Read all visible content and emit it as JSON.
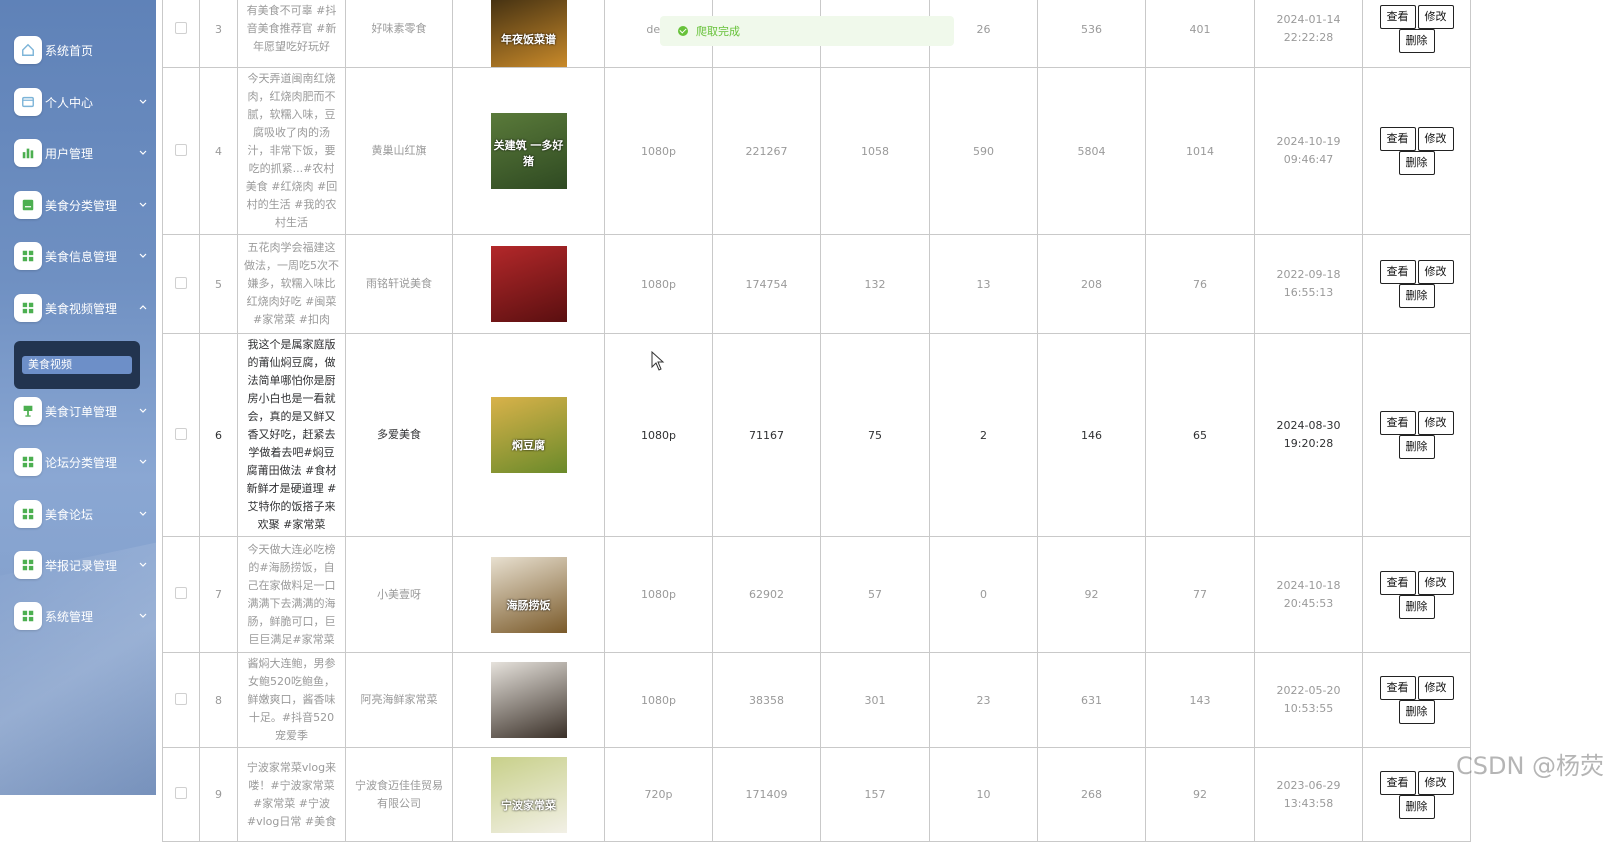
{
  "sidebar": {
    "items": [
      {
        "label": "系统首页",
        "icon": "home-icon",
        "has_chevron": false
      },
      {
        "label": "个人中心",
        "icon": "card-icon",
        "has_chevron": true
      },
      {
        "label": "用户管理",
        "icon": "bar-chart-icon",
        "has_chevron": true
      },
      {
        "label": "美食分类管理",
        "icon": "list-icon",
        "has_chevron": true
      },
      {
        "label": "美食信息管理",
        "icon": "grid-icon",
        "has_chevron": true
      },
      {
        "label": "美食视频管理",
        "icon": "grid-icon",
        "has_chevron": true,
        "expanded": true
      },
      {
        "label": "美食订单管理",
        "icon": "cup-icon",
        "has_chevron": true
      },
      {
        "label": "论坛分类管理",
        "icon": "grid-icon",
        "has_chevron": true
      },
      {
        "label": "美食论坛",
        "icon": "grid-icon",
        "has_chevron": true
      },
      {
        "label": "举报记录管理",
        "icon": "grid-icon",
        "has_chevron": true
      },
      {
        "label": "系统管理",
        "icon": "grid-icon",
        "has_chevron": true
      }
    ],
    "submenu": {
      "active_item": "美食视频"
    }
  },
  "toast": {
    "message": "爬取完成",
    "icon": "check-circle-icon"
  },
  "table": {
    "action_labels": {
      "view": "查看",
      "edit": "修改",
      "delete": "删除"
    },
    "rows": [
      {
        "index": "3",
        "desc": "有美食不可辜 #抖音美食推荐官 #新年愿望吃好玩好",
        "author": "好味素零食",
        "resolution": "de...",
        "c1": "",
        "c2": "",
        "c3": "26",
        "c4": "536",
        "c5": "401",
        "date": "2024-01-14 22:22:28",
        "thumb_text": "年夜饭菜谱",
        "thumb_colors": [
          "#3a2a10",
          "#c98a2a"
        ]
      },
      {
        "index": "4",
        "desc": "今天弄道闽南红烧肉，红烧肉肥而不腻，软糯入味，豆腐吸收了肉的汤汁，非常下饭，要吃的抓紧...#农村美食 #红烧肉 #回村的生活 #我的农村生活",
        "author": "黄巢山红旗",
        "resolution": "1080p",
        "c1": "221267",
        "c2": "1058",
        "c3": "590",
        "c4": "5804",
        "c5": "1014",
        "date": "2024-10-19 09:46:47",
        "thumb_text": "关建筑 一多好猪",
        "thumb_colors": [
          "#5a7a3a",
          "#2f4a22"
        ]
      },
      {
        "index": "5",
        "desc": "五花肉学会福建这做法，一周吃5次不嫌多，软糯入味比红烧肉好吃 #闽菜 #家常菜 #扣肉",
        "author": "雨铭轩说美食",
        "resolution": "1080p",
        "c1": "174754",
        "c2": "132",
        "c3": "13",
        "c4": "208",
        "c5": "76",
        "date": "2022-09-18 16:55:13",
        "thumb_text": "",
        "thumb_colors": [
          "#b3282a",
          "#5a0f10"
        ]
      },
      {
        "index": "6",
        "desc": "我这个是属家庭版的莆仙焖豆腐，做法简单哪怕你是厨房小白也是一看就会，真的是又鲜又香又好吃，赶紧去学做着去吧#焖豆腐莆田做法 #食材新鲜才是硬道理 #艾特你的饭搭子来欢聚 #家常菜",
        "author": "多爱美食",
        "resolution": "1080p",
        "c1": "71167",
        "c2": "75",
        "c3": "2",
        "c4": "146",
        "c5": "65",
        "date": "2024-08-30 19:20:28",
        "thumb_text": "焖豆腐",
        "thumb_colors": [
          "#d9b24a",
          "#6a8a2a"
        ],
        "dark": true
      },
      {
        "index": "7",
        "desc": "今天做大连必吃榜的#海肠捞饭，自己在家做料足一口满满下去满满的海肠，鲜脆可口，巨巨巨满足#家常菜",
        "author": "小美壹呀",
        "resolution": "1080p",
        "c1": "62902",
        "c2": "57",
        "c3": "0",
        "c4": "92",
        "c5": "77",
        "date": "2024-10-18 20:45:53",
        "thumb_text": "海肠捞饭",
        "thumb_colors": [
          "#e8e0d0",
          "#7a5a2a"
        ]
      },
      {
        "index": "8",
        "desc": "酱焖大连鲍，男参女鲍520吃鲍鱼，鲜嫩爽口，酱香味十足。#抖音520宠爱季",
        "author": "阿亮海鲜家常菜",
        "resolution": "1080p",
        "c1": "38358",
        "c2": "301",
        "c3": "23",
        "c4": "631",
        "c5": "143",
        "date": "2022-05-20 10:53:55",
        "thumb_text": "",
        "thumb_colors": [
          "#e6e2dc",
          "#3a3028"
        ]
      },
      {
        "index": "9",
        "desc": "宁波家常菜vlog来喽！#宁波家常菜 #家常菜 #宁波 #vlog日常 #美食",
        "author": "宁波食迈佳佳贸易有限公司",
        "resolution": "720p",
        "c1": "171409",
        "c2": "157",
        "c3": "10",
        "c4": "268",
        "c5": "92",
        "date": "2023-06-29 13:43:58",
        "thumb_text": "宁波家常菜",
        "thumb_colors": [
          "#c8d08a",
          "#f2f0e6"
        ]
      }
    ]
  },
  "watermark": "CSDN @杨荧"
}
